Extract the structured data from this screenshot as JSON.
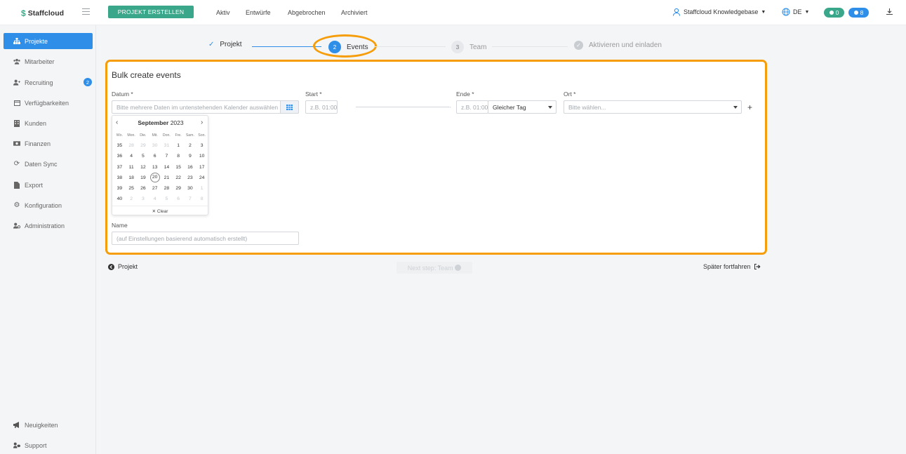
{
  "app": {
    "name": "Staffcloud"
  },
  "header": {
    "create_button": "PROJEKT ERSTELLEN",
    "nav": [
      "Aktiv",
      "Entwürfe",
      "Abgebrochen",
      "Archiviert"
    ],
    "user": "Staffcloud Knowledgebase",
    "language": "DE",
    "chat_count": "0",
    "notification_count": "8"
  },
  "sidebar": {
    "items": [
      {
        "label": "Projekte",
        "icon": "sitemap-icon"
      },
      {
        "label": "Mitarbeiter",
        "icon": "users-icon"
      },
      {
        "label": "Recruiting",
        "icon": "user-plus-icon",
        "badge": "2"
      },
      {
        "label": "Verfügbarkeiten",
        "icon": "calendar-icon"
      },
      {
        "label": "Kunden",
        "icon": "building-icon"
      },
      {
        "label": "Finanzen",
        "icon": "money-icon"
      },
      {
        "label": "Daten Sync",
        "icon": "sync-icon"
      },
      {
        "label": "Export",
        "icon": "file-icon"
      },
      {
        "label": "Konfiguration",
        "icon": "gear-icon"
      },
      {
        "label": "Administration",
        "icon": "user-cog-icon"
      }
    ],
    "bottom": [
      {
        "label": "Neuigkeiten",
        "icon": "megaphone-icon"
      },
      {
        "label": "Support",
        "icon": "support-icon"
      }
    ]
  },
  "stepper": {
    "steps": [
      {
        "num": "✓",
        "label": "Projekt"
      },
      {
        "num": "2",
        "label": "Events"
      },
      {
        "num": "3",
        "label": "Team"
      },
      {
        "num": "✓",
        "label": "Aktivieren und einladen"
      }
    ]
  },
  "form": {
    "title": "Bulk create events",
    "date_label": "Datum *",
    "date_placeholder": "Bitte mehrere Daten im untenstehenden Kalender auswählen",
    "start_label": "Start *",
    "start_placeholder": "z.B. 01:00",
    "end_label": "Ende *",
    "end_placeholder": "z.B. 01:00",
    "end_day_select": "Gleicher Tag",
    "location_label": "Ort *",
    "location_placeholder": "Bitte wählen...",
    "add_symbol": "+",
    "name_label": "Name",
    "name_placeholder": "(auf Einstellungen basierend automatisch erstellt)"
  },
  "calendar": {
    "month": "September",
    "year": "2023",
    "weekday_headers": [
      "Wo.",
      "Mon.",
      "Die.",
      "Mit.",
      "Don.",
      "Fre.",
      "Sam.",
      "Son."
    ],
    "weeks": [
      [
        "35",
        "28",
        "29",
        "30",
        "31",
        "1",
        "2",
        "3"
      ],
      [
        "36",
        "4",
        "5",
        "6",
        "7",
        "8",
        "9",
        "10"
      ],
      [
        "37",
        "11",
        "12",
        "13",
        "14",
        "15",
        "16",
        "17"
      ],
      [
        "38",
        "18",
        "19",
        "20",
        "21",
        "22",
        "23",
        "24"
      ],
      [
        "39",
        "25",
        "26",
        "27",
        "28",
        "29",
        "30",
        "1"
      ],
      [
        "40",
        "2",
        "3",
        "4",
        "5",
        "6",
        "7",
        "8"
      ]
    ],
    "today": "20",
    "clear_label": "✕ Clear"
  },
  "footer": {
    "back_label": "Projekt",
    "next_label": "Next step: Team",
    "later_label": "Später fortfahren"
  },
  "colors": {
    "accent": "#2f8fe8",
    "brand_green": "#3aa78a",
    "highlight": "#f59d0a"
  }
}
